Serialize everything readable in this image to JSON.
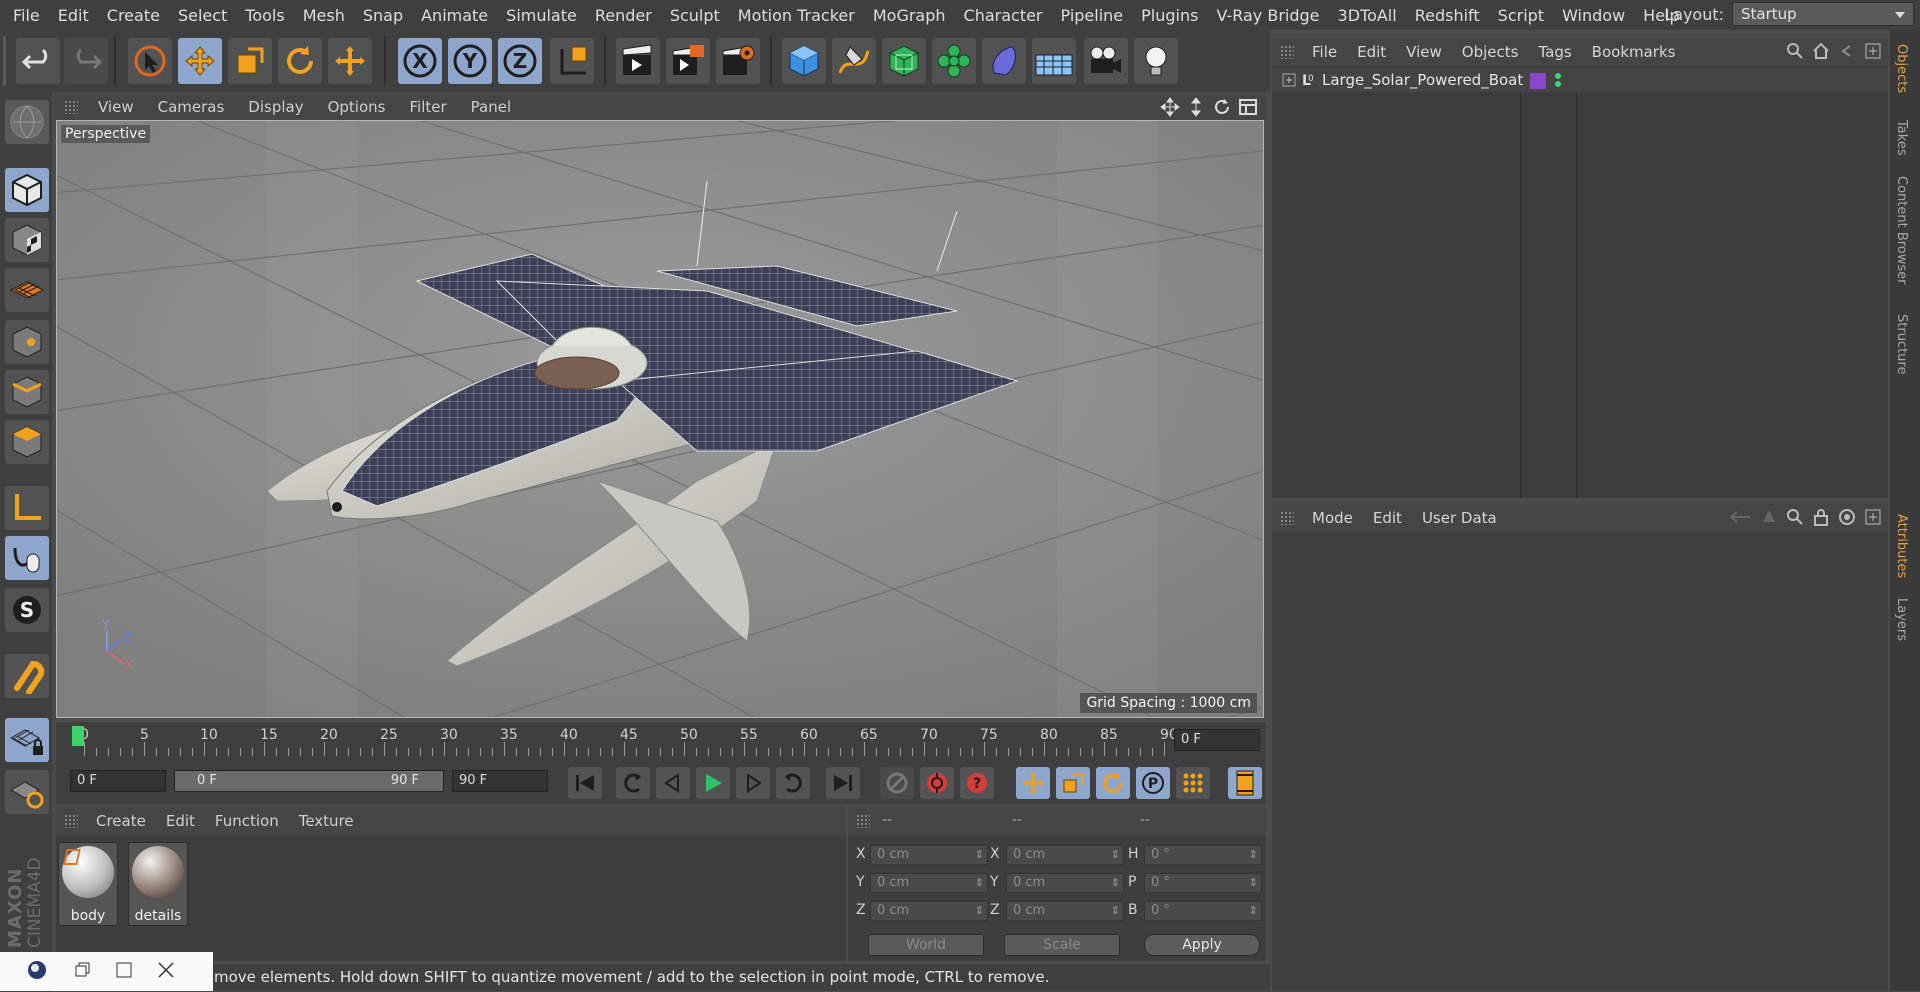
{
  "menubar": {
    "items": [
      "File",
      "Edit",
      "Create",
      "Select",
      "Tools",
      "Mesh",
      "Snap",
      "Animate",
      "Simulate",
      "Render",
      "Sculpt",
      "Motion Tracker",
      "MoGraph",
      "Character",
      "Pipeline",
      "Plugins",
      "V-Ray Bridge",
      "3DToAll",
      "Redshift",
      "Script",
      "Window",
      "Help"
    ],
    "layout_label": "Layout:",
    "layout_value": "Startup"
  },
  "toolbar": {
    "icons": [
      "undo-icon",
      "redo-icon",
      "live-selection-icon",
      "move-icon",
      "scale-icon",
      "rotate-icon",
      "recent-tool-icon",
      "x-axis-lock-icon",
      "y-axis-lock-icon",
      "z-axis-lock-icon",
      "coordinate-system-icon",
      "render-view-icon",
      "render-to-picture-viewer-icon",
      "render-settings-icon",
      "cube-icon",
      "pen-spline-icon",
      "subdivision-surface-icon",
      "cloner-icon",
      "deformer-icon",
      "floor-icon",
      "camera-icon",
      "light-icon"
    ],
    "axis_labels": [
      "X",
      "Y",
      "Z"
    ]
  },
  "viewport": {
    "menu": [
      "View",
      "Cameras",
      "Display",
      "Options",
      "Filter",
      "Panel"
    ],
    "label": "Perspective",
    "grid_spacing": "Grid Spacing : 1000 cm",
    "axis": {
      "x": "X",
      "y": "Y",
      "z": "Z"
    }
  },
  "timeline": {
    "ticks": [
      "0",
      "5",
      "10",
      "15",
      "20",
      "25",
      "30",
      "35",
      "40",
      "45",
      "50",
      "55",
      "60",
      "65",
      "70",
      "75",
      "80",
      "85",
      "90"
    ],
    "current_frame": "0 F"
  },
  "transport": {
    "start_frame": "0 F",
    "range_start": "0 F",
    "range_end": "90 F",
    "end_frame": "90 F"
  },
  "materials": {
    "menu": [
      "Create",
      "Edit",
      "Function",
      "Texture"
    ],
    "items": [
      {
        "name": "body"
      },
      {
        "name": "details"
      }
    ]
  },
  "coordinates": {
    "headers": [
      "--",
      "--",
      "--"
    ],
    "rows": [
      {
        "l1": "X",
        "v1": "0 cm",
        "l2": "X",
        "v2": "0 cm",
        "l3": "H",
        "v3": "0 °"
      },
      {
        "l1": "Y",
        "v1": "0 cm",
        "l2": "Y",
        "v2": "0 cm",
        "l3": "P",
        "v3": "0 °"
      },
      {
        "l1": "Z",
        "v1": "0 cm",
        "l2": "Z",
        "v2": "0 cm",
        "l3": "B",
        "v3": "0 °"
      }
    ],
    "mode1": "World",
    "mode2": "Scale",
    "apply": "Apply"
  },
  "status": {
    "text": "move elements. Hold down SHIFT to quantize movement / add to the selection in point mode, CTRL to remove."
  },
  "brand": "MAXON CINEMA 4D",
  "objects_panel": {
    "menu": [
      "File",
      "Edit",
      "View",
      "Objects",
      "Tags",
      "Bookmarks"
    ],
    "objects": [
      {
        "name": "Large_Solar_Powered_Boat",
        "tag_color": "#8b45c9"
      }
    ]
  },
  "attributes_panel": {
    "menu": [
      "Mode",
      "Edit",
      "User Data"
    ]
  },
  "side_tabs": [
    "Objects",
    "Takes",
    "Content Browser",
    "Structure",
    "Attributes",
    "Layers"
  ],
  "colors": {
    "accent_blue": "#8fa6cc",
    "play_green": "#2fc06a",
    "record_red": "#d43c3c",
    "active_tab": "#e0a04a"
  }
}
